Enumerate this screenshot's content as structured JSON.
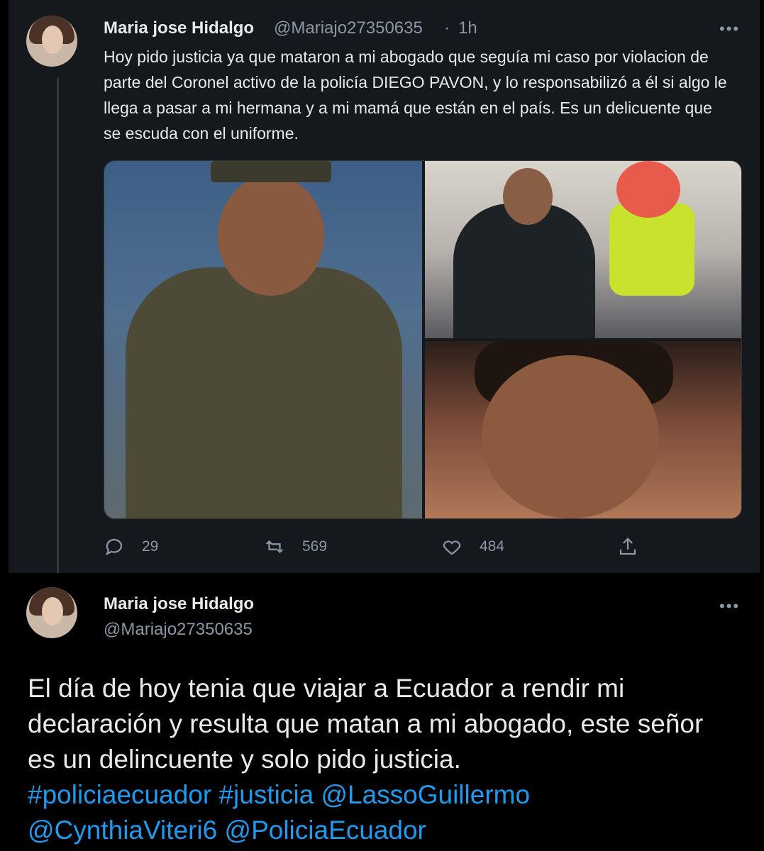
{
  "tweet1": {
    "author_name": "Maria jose Hidalgo",
    "author_handle": "@Mariajo27350635",
    "separator": "·",
    "time": "1h",
    "more": "•••",
    "text": "Hoy pido justicia ya que mataron a mi abogado que seguía mi caso por violacion de parte del Coronel activo de la policía DIEGO PAVON, y lo responsabilizó a él si algo le llega a pasar a mi hermana y a mi mamá que están en el país. Es un delicuente que se escuda con el uniforme.",
    "replies": "29",
    "retweets": "569",
    "likes": "484"
  },
  "tweet2": {
    "author_name": "Maria jose Hidalgo",
    "author_handle": "@Mariajo27350635",
    "more": "•••",
    "text": "El día de hoy tenia que viajar a Ecuador a rendir mi declaración y resulta que matan a mi abogado, este señor es un delincuente y solo pido justicia.",
    "links": [
      "#policiaecuador",
      "#justicia",
      "@LassoGuillermo",
      "@CynthiaViteri6",
      "@PoliciaEcuador"
    ]
  },
  "icons": {
    "reply": "reply-icon",
    "retweet": "retweet-icon",
    "like": "heart-icon",
    "share": "share-icon"
  },
  "colors": {
    "background": "#000000",
    "card": "#15181c",
    "text": "#e7e9ea",
    "muted": "#8b98a5",
    "link": "#1d9bf0"
  }
}
